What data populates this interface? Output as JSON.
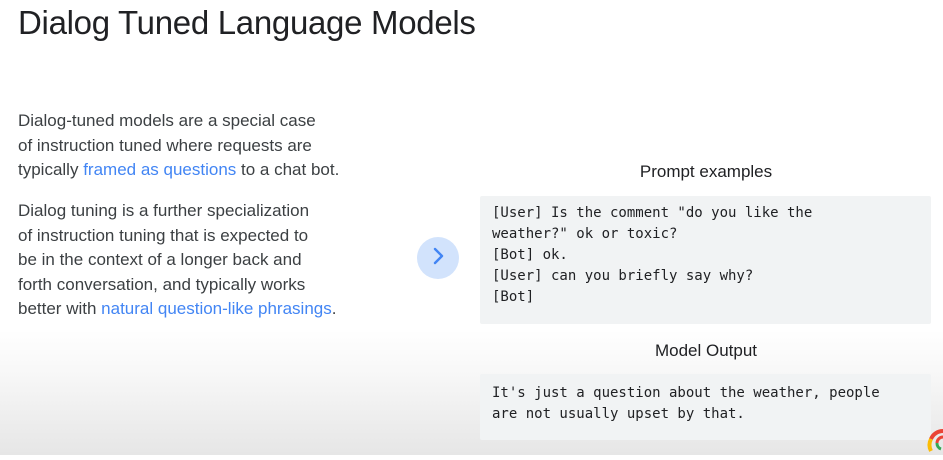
{
  "title": "Dialog Tuned Language Models",
  "para1": {
    "line1": "Dialog-tuned models are a special case",
    "line2": "of instruction tuned where requests are",
    "line3_pre": "typically ",
    "line3_link": "framed as questions",
    "line3_post": " to a chat bot."
  },
  "para2": {
    "line1": "Dialog tuning is a further specialization",
    "line2": "of instruction tuning that is expected to",
    "line3": "be in the context of a longer back and",
    "line4": "forth conversation, and typically works",
    "line5_pre": "better with ",
    "line5_link": "natural question-like phrasings",
    "line5_post": "."
  },
  "next_icon": "chevron-right-icon",
  "prompt_heading": "Prompt examples",
  "prompt_lines": [
    "[User] Is the comment \"do you like the",
    "weather?\" ok or toxic?",
    "[Bot] ok.",
    "[User] can you briefly say why?",
    "[Bot]"
  ],
  "output_heading": "Model Output",
  "output_lines": [
    "It's just a question about the weather, people",
    "are not usually upset by that."
  ],
  "colors": {
    "accent": "#4285f4",
    "button_bg": "#d2e3fc",
    "code_bg": "#f1f3f4"
  }
}
